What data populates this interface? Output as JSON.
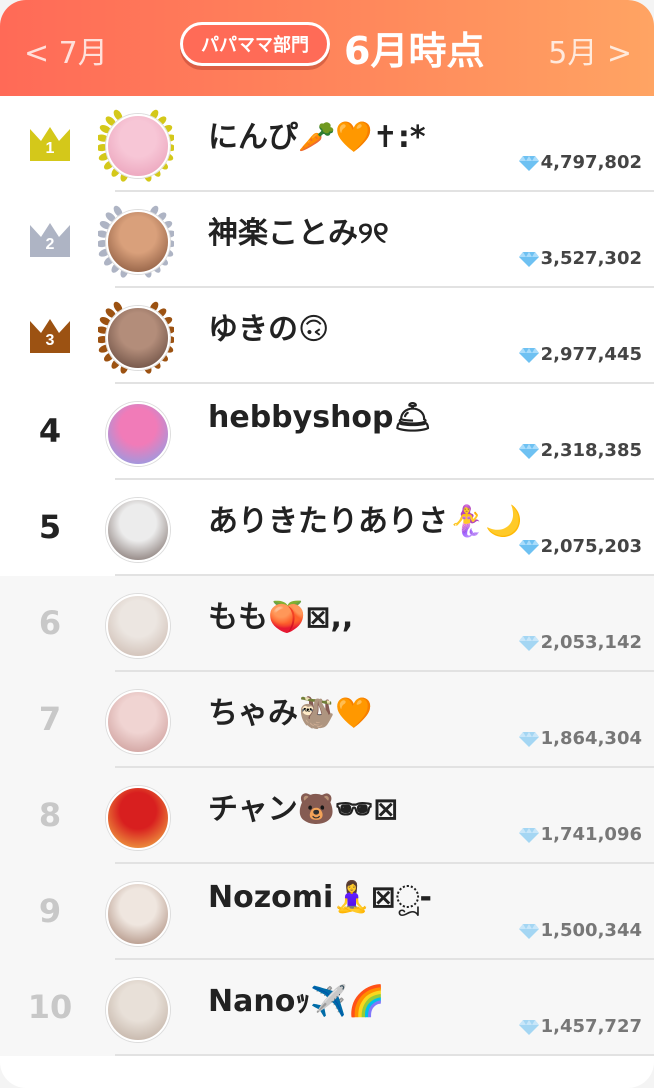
{
  "header": {
    "prev_label": "< 7月",
    "category_label": "パパママ部門",
    "title": "6月時点",
    "next_label": "5月 >"
  },
  "ranking": [
    {
      "rank": "1",
      "name": "にんぴ🥕🧡✝︎:*",
      "score": "4,797,802",
      "medal": "gold"
    },
    {
      "rank": "2",
      "name": "神楽ことみ୨୧",
      "score": "3,527,302",
      "medal": "silver"
    },
    {
      "rank": "3",
      "name": "ゆきの🙃",
      "score": "2,977,445",
      "medal": "bronze"
    },
    {
      "rank": "4",
      "name": "hebbyshop🛎",
      "score": "2,318,385",
      "medal": ""
    },
    {
      "rank": "5",
      "name": "ありきたりありさ🧜‍♀️🌙",
      "score": "2,075,203",
      "medal": ""
    },
    {
      "rank": "6",
      "name": "もも🍑⊠,,",
      "score": "2,053,142",
      "medal": ""
    },
    {
      "rank": "7",
      "name": "ちゃみ🦥🧡",
      "score": "1,864,304",
      "medal": ""
    },
    {
      "rank": "8",
      "name": "チャン🐻🕶⊠",
      "score": "1,741,096",
      "medal": ""
    },
    {
      "rank": "9",
      "name": "Nozomi🧘‍♀️⊠ූ-",
      "score": "1,500,344",
      "medal": ""
    },
    {
      "rank": "10",
      "name": "Nanoｯ✈️🌈",
      "score": "1,457,727",
      "medal": ""
    }
  ],
  "colors": {
    "header_start": "#ff6a57",
    "header_end": "#ffa463",
    "gold": "#d4c81a",
    "silver": "#aeb4c4",
    "bronze": "#9c5212"
  },
  "icons": {
    "crown": "crown-icon",
    "gem": "diamond-icon",
    "laurel": "laurel-wreath-icon"
  }
}
